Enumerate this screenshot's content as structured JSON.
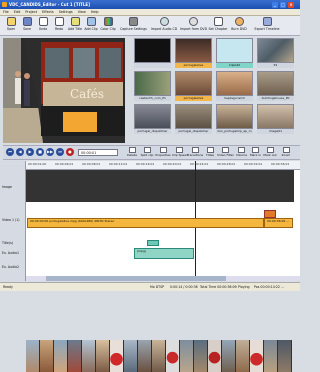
{
  "window": {
    "title": "VDC_CANDIDS_Editor - Cut 1 [TITLE]"
  },
  "menu": [
    "File",
    "Edit",
    "Project",
    "Effects",
    "Settings",
    "View",
    "Help"
  ],
  "toolbar": [
    {
      "label": "Open",
      "icon": "folder-open-icon"
    },
    {
      "label": "Save",
      "icon": "save-icon"
    },
    {
      "label": "Undo",
      "icon": "undo-icon"
    },
    {
      "label": "Redo",
      "icon": "redo-icon"
    },
    {
      "label": "Add Title",
      "icon": "add-title-icon"
    },
    {
      "label": "Add Clip",
      "icon": "add-clip-icon"
    },
    {
      "label": "Color Clip",
      "icon": "color-clip-icon"
    },
    {
      "label": "Capture Settings",
      "icon": "capture-icon"
    },
    {
      "label": "Import Audio CD",
      "icon": "audio-cd-icon"
    },
    {
      "label": "Import from DVD",
      "icon": "dvd-icon"
    },
    {
      "label": "Set Chapter",
      "icon": "chapter-icon"
    },
    {
      "label": "Burn DVD",
      "icon": "burn-icon"
    },
    {
      "label": "Export Timeline",
      "icon": "export-icon"
    }
  ],
  "bin": [
    {
      "caption": "",
      "color": "#111111"
    },
    {
      "caption": "portugalalive",
      "color": "#6f4d3a"
    },
    {
      "caption": "Clipb40",
      "color": "#bfe0ea"
    },
    {
      "caption": "P1",
      "color": "#7a8894"
    },
    {
      "caption": "castanhh_com_P1",
      "color": "#6a7250"
    },
    {
      "caption": "portugalalive",
      "color": "#a07a5a"
    },
    {
      "caption": "heptagonsmll",
      "color": "#c49a70"
    },
    {
      "caption": "buildingshouse_P0",
      "color": "#8a7a66"
    },
    {
      "caption": "portugal_dispatcher",
      "color": "#6b6e78"
    },
    {
      "caption": "portugal_dispatcher",
      "color": "#7b6f5f"
    },
    {
      "caption": "box_portugalmp_ap_m",
      "color": "#9a8672"
    },
    {
      "caption": "image01",
      "color": "#b0a090"
    },
    {
      "caption": "image01",
      "color": "#8e7c6a"
    },
    {
      "caption": "image01",
      "color": "#c9a87e"
    }
  ],
  "transport": {
    "timecode": "00:00:01",
    "buttons": [
      "⏮",
      "◀",
      "▶",
      "■",
      "▶▶",
      "⏭",
      "●"
    ]
  },
  "edit_tools": [
    "Delete",
    "Split clip",
    "Properties",
    "Clip Speed",
    "Transitions",
    "Titles",
    "Video Filter",
    "Volume",
    "Mark in",
    "Mark out",
    "Zoom"
  ],
  "tracks": [
    "Image",
    "Video 1 (1)",
    "Title(s)",
    "Ex. Audio1",
    "Ex. Audio2"
  ],
  "ruler": [
    "00:00:01;00",
    "00:00:06;01",
    "00:00:08;01",
    "00:00:12;01",
    "00:00:16;01",
    "00:00:20;01",
    "00:00:24;01",
    "00:00:28;01",
    "00:00:32;01",
    "00:00:36;01"
  ],
  "timeline": {
    "video_clip_label": "00:00:00:00  portugalalive.mpg  (640x480) 48kHz Stereo",
    "video_clip_label2": "00:00:36:09 ...",
    "title_clip_label": "Title",
    "audio_clip_label": "(mpg)"
  },
  "status": {
    "ready": "Ready",
    "mode": "Mo DTSP",
    "timecode": "0:00:14 / 0:00:36",
    "total": "Total Time 00:00:36:09",
    "playing": "Playing",
    "position": "Pos 00:00:14:22 ..."
  }
}
